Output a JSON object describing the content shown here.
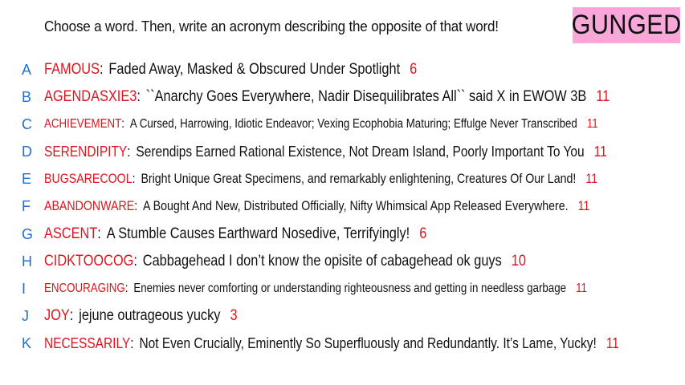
{
  "prompt": "Choose a word. Then, write an acronym describing the opposite of that word!",
  "badge": "GUNGED",
  "colors": {
    "letter": "#1f6fd6",
    "word": "#e0141e",
    "number": "#e0141e",
    "badge_bg": "#f7a8d8"
  },
  "entries": [
    {
      "letter": "A",
      "word": "FAMOUS",
      "acronym": "Faded Away, Masked & Obscured Under Spotlight",
      "score": "6"
    },
    {
      "letter": "B",
      "word": "AGENDASXIE3",
      "acronym": "``Anarchy Goes Everywhere, Nadir Disequilibrates All`` said X in EWOW 3B",
      "score": "11"
    },
    {
      "letter": "C",
      "word": "ACHIEVEMENT",
      "acronym": "A Cursed, Harrowing, Idiotic Endeavor; Vexing Ecophobia Maturing; Effulge Never Transcribed",
      "score": "11"
    },
    {
      "letter": "D",
      "word": "SERENDIPITY",
      "acronym": "Serendips Earned Rational Existence, Not Dream Island, Poorly Important To You",
      "score": "11"
    },
    {
      "letter": "E",
      "word": "BUGSARECOOL",
      "acronym": "Bright Unique Great Specimens, and remarkably enlightening, Creatures Of Our Land!",
      "score": "11"
    },
    {
      "letter": "F",
      "word": "ABANDONWARE",
      "acronym": "A Bought And New, Distributed Officially, Nifty Whimsical App Released Everywhere.",
      "score": "11"
    },
    {
      "letter": "G",
      "word": "ASCENT",
      "acronym": "A Stumble Causes Earthward Nosedive, Terrifyingly!",
      "score": "6"
    },
    {
      "letter": "H",
      "word": "CIDKTOOCOG",
      "acronym": "Cabbagehead I don’t know the opisite of cabagehead ok guys",
      "score": "10"
    },
    {
      "letter": "I",
      "word": "ENCOURAGING",
      "acronym": "Enemies never comforting or understanding righteousness and getting in needless garbage",
      "score": "11"
    },
    {
      "letter": "J",
      "word": "JOY",
      "acronym": "jejune outrageous yucky",
      "score": "3"
    },
    {
      "letter": "K",
      "word": "NECESSARILY",
      "acronym": "Not Even Crucially, Eminently So Superfluously and Redundantly. It’s Lame, Yucky!",
      "score": "11"
    }
  ]
}
